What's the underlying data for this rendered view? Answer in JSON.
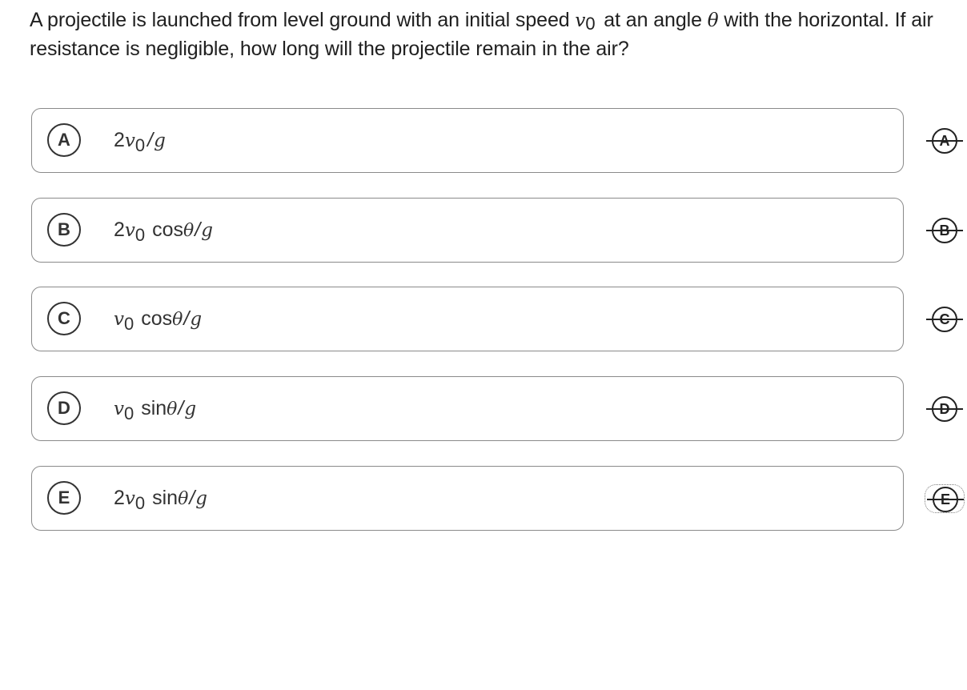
{
  "question": {
    "part1": "A projectile is launched from level ground with an initial speed ",
    "v": "v",
    "v_sub": "0",
    "part2": " at an angle ",
    "theta": "θ",
    "part3": " with the horizontal. If air resistance is negligible, how long will the projectile remain in the air?"
  },
  "choices": [
    {
      "letter": "A",
      "coef": "2",
      "v": "v",
      "sub": "0",
      "fn": "",
      "theta": "",
      "slash": "/",
      "g": "g"
    },
    {
      "letter": "B",
      "coef": "2",
      "v": "v",
      "sub": "0",
      "fn": " cos",
      "theta": "θ",
      "slash": "/",
      "g": "g"
    },
    {
      "letter": "C",
      "coef": "",
      "v": "v",
      "sub": "0",
      "fn": " cos",
      "theta": "θ",
      "slash": "/",
      "g": "g"
    },
    {
      "letter": "D",
      "coef": "",
      "v": "v",
      "sub": "0",
      "fn": " sin",
      "theta": "θ",
      "slash": "/",
      "g": "g"
    },
    {
      "letter": "E",
      "coef": "2",
      "v": "v",
      "sub": "0",
      "fn": " sin",
      "theta": "θ",
      "slash": "/",
      "g": "g"
    }
  ],
  "strikethrough_buttons": [
    {
      "letter": "A"
    },
    {
      "letter": "B"
    },
    {
      "letter": "C"
    },
    {
      "letter": "D"
    },
    {
      "letter": "E"
    }
  ]
}
